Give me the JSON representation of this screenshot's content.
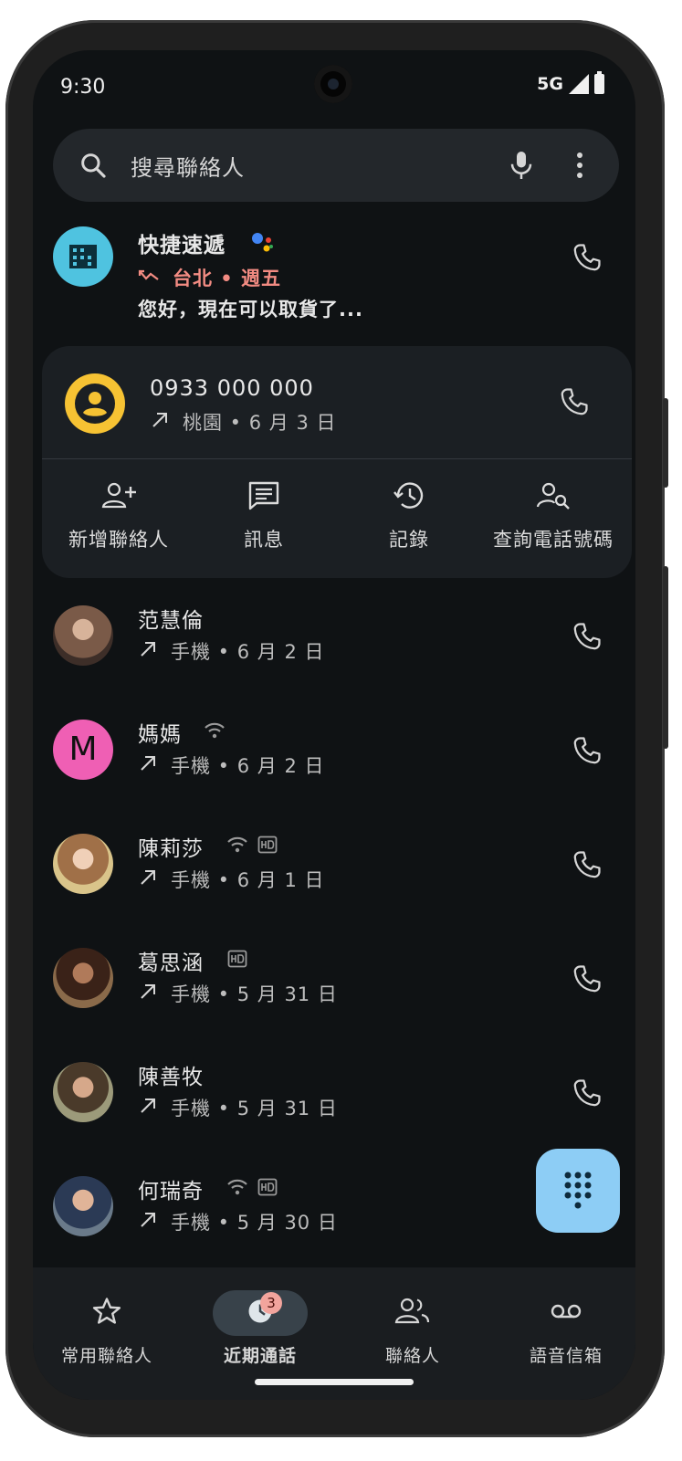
{
  "status_bar": {
    "time": "9:30",
    "network": "5G"
  },
  "search": {
    "placeholder": "搜尋聯絡人"
  },
  "business_call": {
    "name": "快捷速遞",
    "detail": "台北 • 週五",
    "preview": "您好，現在可以取貨了..."
  },
  "expanded_call": {
    "number": "0933 000 000",
    "detail": "桃園 • 6 月 3 日",
    "actions": [
      "新增聯絡人",
      "訊息",
      "記錄",
      "查詢電話號碼"
    ]
  },
  "calls": [
    {
      "name": "范慧倫",
      "detail": "手機 • 6 月 2 日",
      "avatar_color": "#7a5a48"
    },
    {
      "name": "媽媽",
      "detail": "手機 • 6 月 2 日",
      "avatar_letter": "M",
      "avatar_color": "#ef5fb4"
    },
    {
      "name": "陳莉莎",
      "detail": "手機 • 6 月 1 日",
      "avatar_color": "#c9a070"
    },
    {
      "name": "葛思涵",
      "detail": "手機 • 5 月 31 日",
      "avatar_color": "#6b3d2b"
    },
    {
      "name": "陳善牧",
      "detail": "手機 • 5 月 31 日",
      "avatar_color": "#8a7a5a"
    },
    {
      "name": "何瑞奇",
      "detail": "手機 • 5 月 30 日",
      "avatar_color": "#2b3a55"
    }
  ],
  "bottom_nav": {
    "items": [
      "常用聯絡人",
      "近期通話",
      "聯絡人",
      "語音信箱"
    ],
    "badge_count": "3"
  },
  "colors": {
    "background": "#0f1214",
    "accent_blue": "#8dcdf5",
    "missed_red": "#f28b82",
    "business_avatar": "#4fc3e0",
    "unknown_avatar": "#f6c233"
  }
}
